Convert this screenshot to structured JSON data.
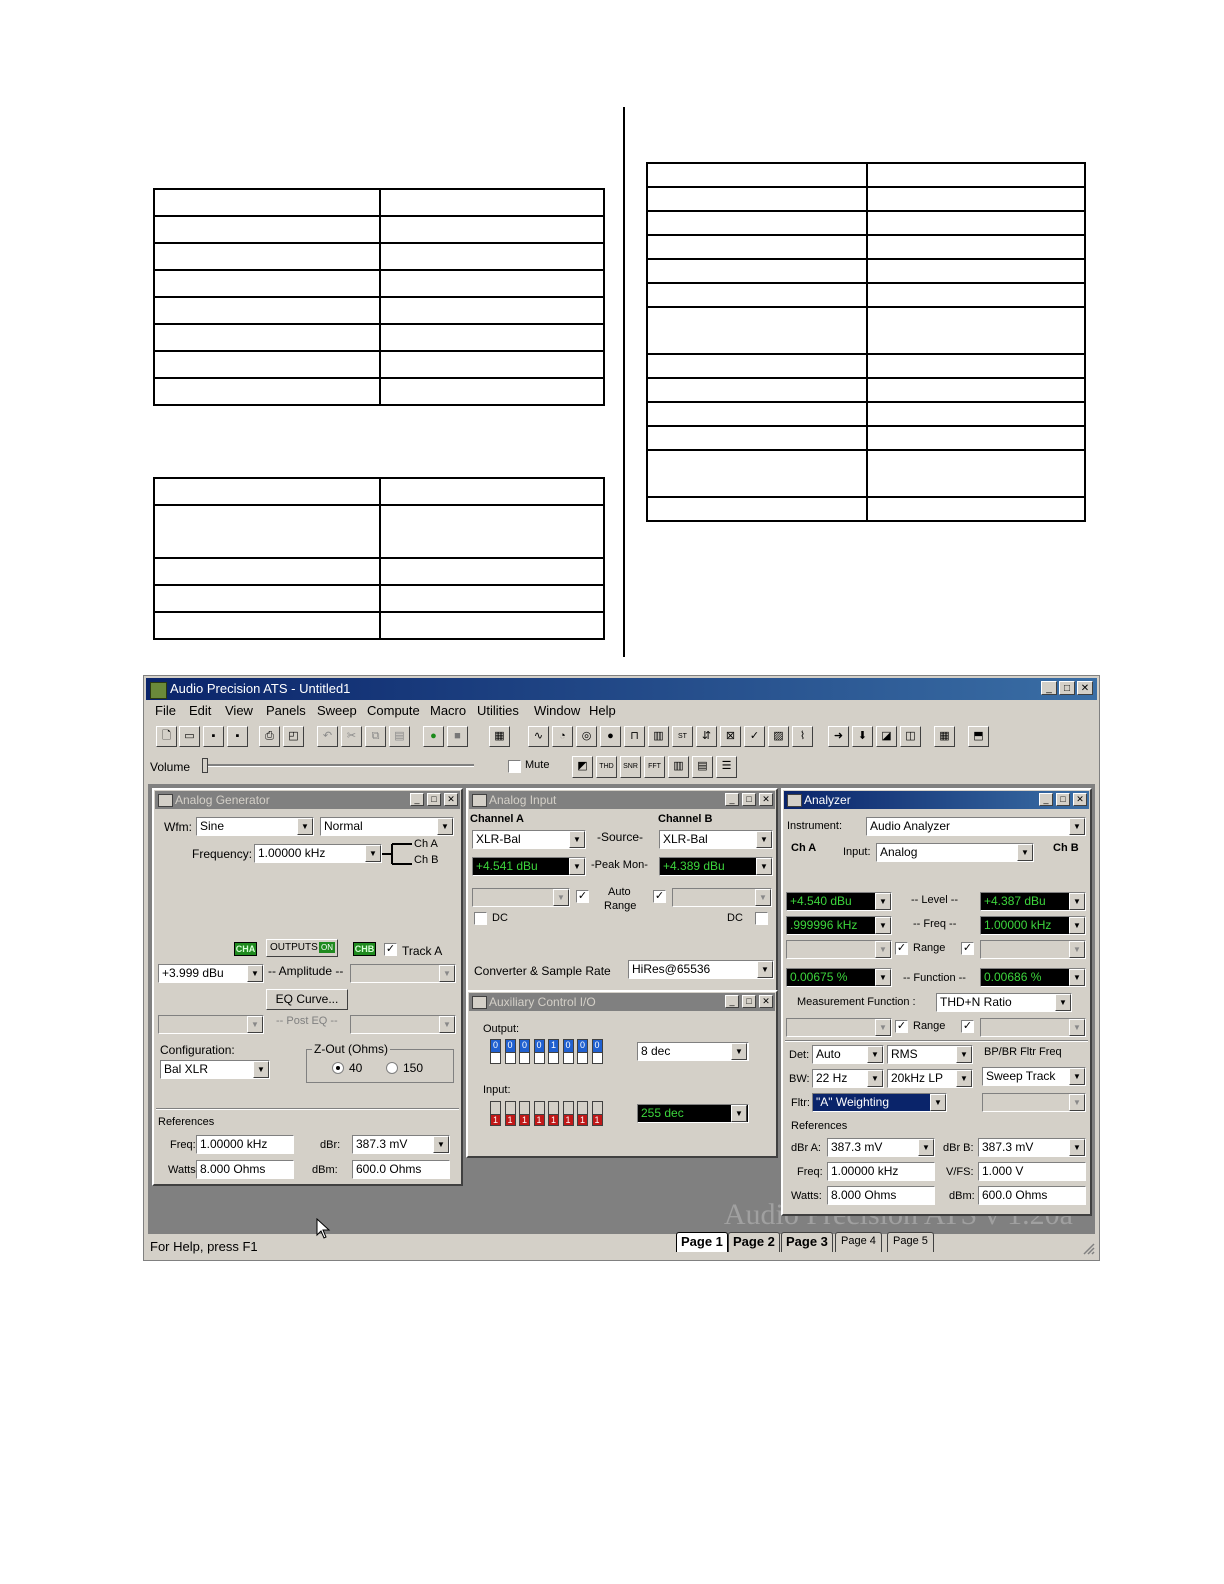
{
  "app": {
    "title": "Audio Precision ATS - Untitled1",
    "menu": [
      "File",
      "Edit",
      "View",
      "Panels",
      "Sweep",
      "Compute",
      "Macro",
      "Utilities",
      "Window",
      "Help"
    ],
    "volume_label": "Volume",
    "mute_label": "Mute",
    "brand": "Audio Precision ATS v 1.20a",
    "status": "For Help, press F1",
    "pages": [
      "Page 1",
      "Page 2",
      "Page 3",
      "Page 4",
      "Page 5"
    ]
  },
  "gen": {
    "title": "Analog Generator",
    "wfm_label": "Wfm:",
    "wfm_value": "Sine",
    "wfm_mode": "Normal",
    "freq_label": "Frequency:",
    "freq_value": "1.00000 kHz",
    "cha": "Ch A",
    "chb": "Ch B",
    "cha_btn": "CHA",
    "outputs_btn": "OUTPUTS",
    "on": "ON",
    "chb_btn": "CHB",
    "track": "Track A",
    "amp_value": "+3.999  dBu",
    "amp_label": "-- Amplitude --",
    "eq_btn": "EQ Curve...",
    "posteq": "-- Post EQ --",
    "config_label": "Configuration:",
    "config_value": "Bal XLR",
    "zout_label": "Z-Out (Ohms)",
    "z40": "40",
    "z150": "150",
    "refs_label": "References",
    "ref_freq_label": "Freq:",
    "ref_freq_value": "1.00000 kHz",
    "dbr_label": "dBr:",
    "dbr_value": "387.3  mV",
    "watts_label": "Watts:",
    "watts_value": "8.000   Ohms",
    "dbm_label": "dBm:",
    "dbm_value": "600.0   Ohms"
  },
  "input": {
    "title": "Analog Input",
    "cha": "Channel A",
    "chb": "Channel B",
    "src_a": "XLR-Bal",
    "src_b": "XLR-Bal",
    "src_label": "-Source-",
    "peak_a": "+4.541  dBu",
    "peak_b": "+4.389  dBu",
    "peak_label": "-Peak Mon-",
    "auto": "Auto",
    "range": "Range",
    "dc": "DC",
    "conv_label": "Converter & Sample Rate",
    "conv_value": "HiRes@65536"
  },
  "aux": {
    "title": "Auxiliary Control I/O",
    "output_label": "Output:",
    "output_bits": [
      "0",
      "0",
      "0",
      "0",
      "1",
      "0",
      "0",
      "0"
    ],
    "output_value": "8     dec",
    "input_label": "Input:",
    "input_bits": [
      "1",
      "1",
      "1",
      "1",
      "1",
      "1",
      "1",
      "1"
    ],
    "input_value": "255     dec"
  },
  "analyzer": {
    "title": "Analyzer",
    "instrument_label": "Instrument:",
    "instrument_value": "Audio Analyzer",
    "cha": "Ch A",
    "chb": "Ch B",
    "input_label": "Input:",
    "input_value": "Analog",
    "level_a": "+4.540  dBu",
    "level_b": "+4.387  dBu",
    "level_label": "-- Level --",
    "freq_a": ".999996 kHz",
    "freq_b": "1.00000 kHz",
    "freq_label": "-- Freq --",
    "range": "Range",
    "func_a": "0.00675  %",
    "func_b": "0.00686  %",
    "func_label": "-- Function --",
    "mf_label": "Measurement Function :",
    "mf_value": "THD+N Ratio",
    "det_label": "Det:",
    "det_value": "Auto",
    "det_mode": "RMS",
    "bp_label": "BP/BR Fltr Freq",
    "bw_label": "BW:",
    "bw_low": "22 Hz",
    "bw_high": "20kHz LP",
    "sweep_track": "Sweep Track",
    "fltr_label": "Fltr:",
    "fltr_value": "\"A\" Weighting",
    "refs_label": "References",
    "dbra_label": "dBr A:",
    "dbra_value": "387.3  mV",
    "dbrb_label": "dBr B:",
    "dbrb_value": "387.3  mV",
    "freq_ref_label": "Freq:",
    "freq_ref_value": "1.00000 kHz",
    "vfs_label": "V/FS:",
    "vfs_value": "1.000    V",
    "watts_label": "Watts:",
    "watts_value": "8.000   Ohms",
    "dbm_label": "dBm:",
    "dbm_value": "600.0   Ohms"
  }
}
